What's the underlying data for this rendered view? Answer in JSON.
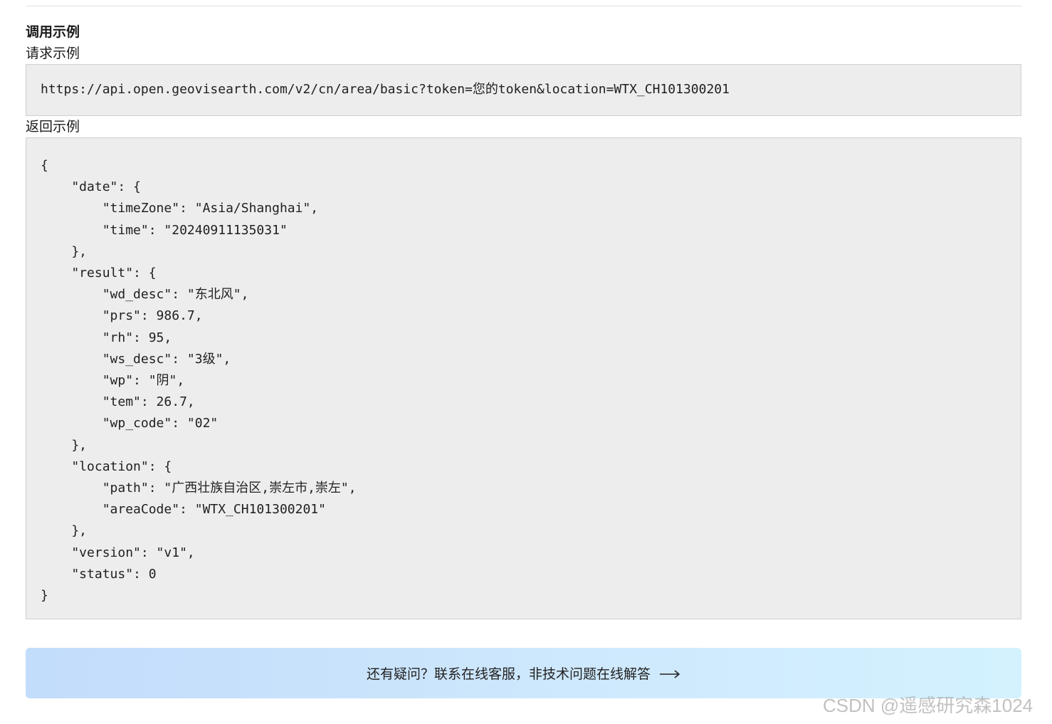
{
  "section": {
    "title": "调用示例",
    "request_label": "请求示例",
    "response_label": "返回示例"
  },
  "request": {
    "url": "https://api.open.geovisearth.com/v2/cn/area/basic?token=您的token&location=WTX_CH101300201"
  },
  "response": {
    "lines": [
      "{",
      "    \"date\": {",
      "        \"timeZone\": \"Asia/Shanghai\",",
      "        \"time\": \"20240911135031\"",
      "    },",
      "    \"result\": {",
      "        \"wd_desc\": \"东北风\",",
      "        \"prs\": 986.7,",
      "        \"rh\": 95,",
      "        \"ws_desc\": \"3级\",",
      "        \"wp\": \"阴\",",
      "        \"tem\": 26.7,",
      "        \"wp_code\": \"02\"",
      "    },",
      "    \"location\": {",
      "        \"path\": \"广西壮族自治区,崇左市,崇左\",",
      "        \"areaCode\": \"WTX_CH101300201\"",
      "    },",
      "    \"version\": \"v1\",",
      "    \"status\": 0",
      "}"
    ]
  },
  "help": {
    "text": "还有疑问？联系在线客服，非技术问题在线解答",
    "icon": "arrow-right-icon"
  },
  "watermark": {
    "text": "CSDN @遥感研究森1024"
  }
}
